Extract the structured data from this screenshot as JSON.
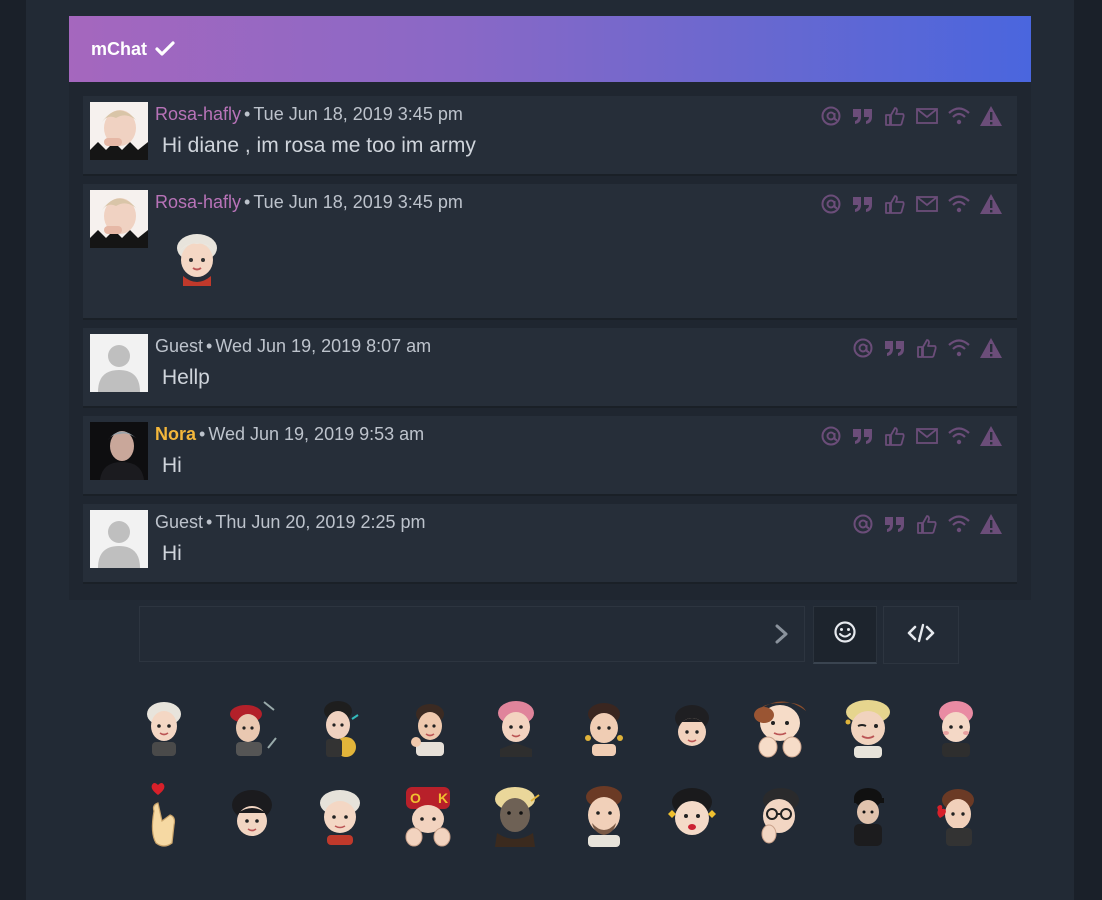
{
  "header": {
    "title": "mChat"
  },
  "messages": [
    {
      "user": "Rosa-hafly",
      "user_class": "user-rosa",
      "time": "Tue Jun 18, 2019 3:45 pm",
      "text": "Hi diane , im rosa me too im army",
      "avatar": "rosa",
      "icons": [
        "at-icon",
        "quote-icon",
        "like-icon",
        "pm-icon",
        "ip-icon",
        "report-icon"
      ]
    },
    {
      "user": "Rosa-hafly",
      "user_class": "user-rosa",
      "time": "Tue Jun 18, 2019 3:45 pm",
      "text": "",
      "sticker": true,
      "avatar": "rosa",
      "icons": [
        "at-icon",
        "quote-icon",
        "like-icon",
        "pm-icon",
        "ip-icon",
        "report-icon"
      ]
    },
    {
      "user": "Guest",
      "user_class": "user-guest",
      "time": "Wed Jun 19, 2019 8:07 am",
      "text": "Hellp",
      "avatar": "guest",
      "icons": [
        "at-icon",
        "quote-icon",
        "like-icon",
        "ip-icon",
        "report-icon"
      ]
    },
    {
      "user": "Nora",
      "user_class": "user-nora",
      "time": "Wed Jun 19, 2019 9:53 am",
      "text": "Hi",
      "avatar": "nora",
      "icons": [
        "at-icon",
        "quote-icon",
        "like-icon",
        "pm-icon",
        "ip-icon",
        "report-icon"
      ]
    },
    {
      "user": "Guest",
      "user_class": "user-guest",
      "time": "Thu Jun 20, 2019 2:25 pm",
      "text": "Hi",
      "avatar": "guest",
      "icons": [
        "at-icon",
        "quote-icon",
        "like-icon",
        "ip-icon",
        "report-icon"
      ]
    }
  ],
  "input": {
    "placeholder": ""
  },
  "smilies": {
    "row1": [
      "smiley-white-hair",
      "smiley-red-beret",
      "smiley-gold-bear",
      "smiley-brown-hair",
      "smiley-pink-hair",
      "smiley-earrings",
      "smiley-dark-hair",
      "smiley-chin-rest",
      "smiley-blonde-wink",
      "smiley-pink-blush"
    ],
    "row2": [
      "smiley-finger-heart",
      "smiley-black-hair",
      "smiley-white-hair-2",
      "smiley-ok-cap",
      "smiley-dark-skin",
      "smiley-beard",
      "smiley-yellow-earrings",
      "smiley-glasses",
      "smiley-black-cap",
      "smiley-red-heart"
    ]
  },
  "colors": {
    "accent_start": "#a567be",
    "accent_end": "#4a66de",
    "action_icon": "#6b4d79",
    "username_rosa": "#b873b8",
    "username_nora": "#f4b73b"
  }
}
